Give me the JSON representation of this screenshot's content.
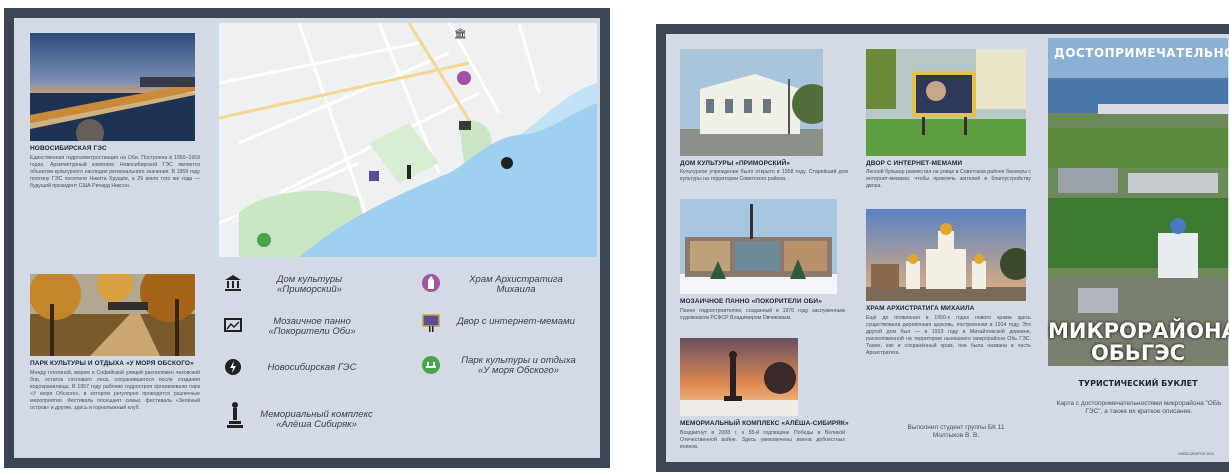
{
  "left_page": {
    "captions": {
      "hydro": "НОВОСИБИРСКАЯ ГЭС",
      "park": "ПАРК КУЛЬТУРЫ И ОТДЫХА «У МОРЯ ОБСКОГО»"
    },
    "texts": {
      "hydro": "Единственная гидроэлектростанция на Оби. Построена в 1950–1959 годах. Архитектурный комплекс Новосибирской ГЭС является объектом культурного наследия регионального значения. В 1959 году плотину ГЭС посетили Никита Хрущёв, а 29 июля того же года — будущий президент США Ричард Никсон.",
      "park": "Между плотиной, морем и Софийской улицей расположен чеховский бор, остаток соснового леса, сохранившегося после создания водохранилища. В 1957 году рабочие гидростроя организовали парк «У моря Обского», в котором регулярно проводятся различные мероприятия. Фестиваль посещают семьи, фестиваль «Зелёный остров» и другие, здесь и горнолыжный клуб."
    },
    "legend": [
      {
        "icon": "bank-icon",
        "label": "Дом культуры «Приморский»"
      },
      {
        "icon": "church-icon",
        "label": "Храм Архистратига Михаила"
      },
      {
        "icon": "mosaic-icon",
        "label": "Мозаичное панно «Покорители Оби»"
      },
      {
        "icon": "billboard-icon",
        "label": "Двор с интернет-мемами"
      },
      {
        "icon": "dam-icon",
        "label": "Новосибирская ГЭС"
      },
      {
        "icon": "park-icon",
        "label": "Парк культуры и отдыха «У моря Обского»"
      },
      {
        "icon": "monument-icon",
        "label": "Мемориальный комплекс «Алёша Сибиряк»"
      }
    ]
  },
  "right_page": {
    "captions": {
      "house": "ДОМ КУЛЬТУРЫ «ПРИМОРСКИЙ»",
      "billboard": "ДВОР С ИНТЕРНЕТ-МЕМАМИ",
      "mosaic": "МОЗАИЧНОЕ ПАННО «ПОКОРИТЕЛИ ОБИ»",
      "church": "ХРАМ АРХИСТРАТИГА МИХАИЛА",
      "memorial": "МЕМОРИАЛЬНЫЙ КОМПЛЕКС «АЛЁША-СИБИРЯК»"
    },
    "texts": {
      "house": "Культурное учреждение было открыто в 1958 году. Старейший дом культуры на территории Советского района.",
      "billboard": "Лесной бульвар разместил на улице в Советском районе баннеры с интернет-мемами, чтобы привлечь жителей в благоустройству двора.",
      "mosaic": "Панно гидростроителям, созданный в 1970 году заслуженным художником РСФСР Владимиром Овчиковым.",
      "church": "Ещё до появления в 1950-х годах нового храма здесь существовала деревянная церковь, построенная в 1914 году. Это другой дом был — в 1913 году в Михайловской деревне, расположенной на территории нынешнего микрорайона Обь ГЭС. Также, как и сохранённый храм, она была названа в честь Архистратига.",
      "memorial": "Воздвигнут в 2008 г. к 55-й годовщине Победы в Великой Отечественной войне. Здесь увековечены имена доблестных воинов.",
      "credit": "Выполнил студент группы БК 11 Молтыков В. В."
    },
    "cover": {
      "top": "ДОСТОПРИМЕЧАТЕЛЬНОСТИ",
      "big1": "МИКРОРАЙОНА",
      "big2": "ОБЬГЭС",
      "subtitle": "ТУРИСТИЧЕСКИЙ БУКЛЕТ",
      "desc": "Карта с достопримечательностями микрорайона \"ОБЬ ГЭС\", а также их краткое описание.",
      "footer": "НОВОСИБИРСК 2024"
    }
  },
  "colors": {
    "frame": "#3c4552",
    "paper": "#d4d9e6",
    "water": "#9fd0ef",
    "park": "#c9e6c2"
  }
}
